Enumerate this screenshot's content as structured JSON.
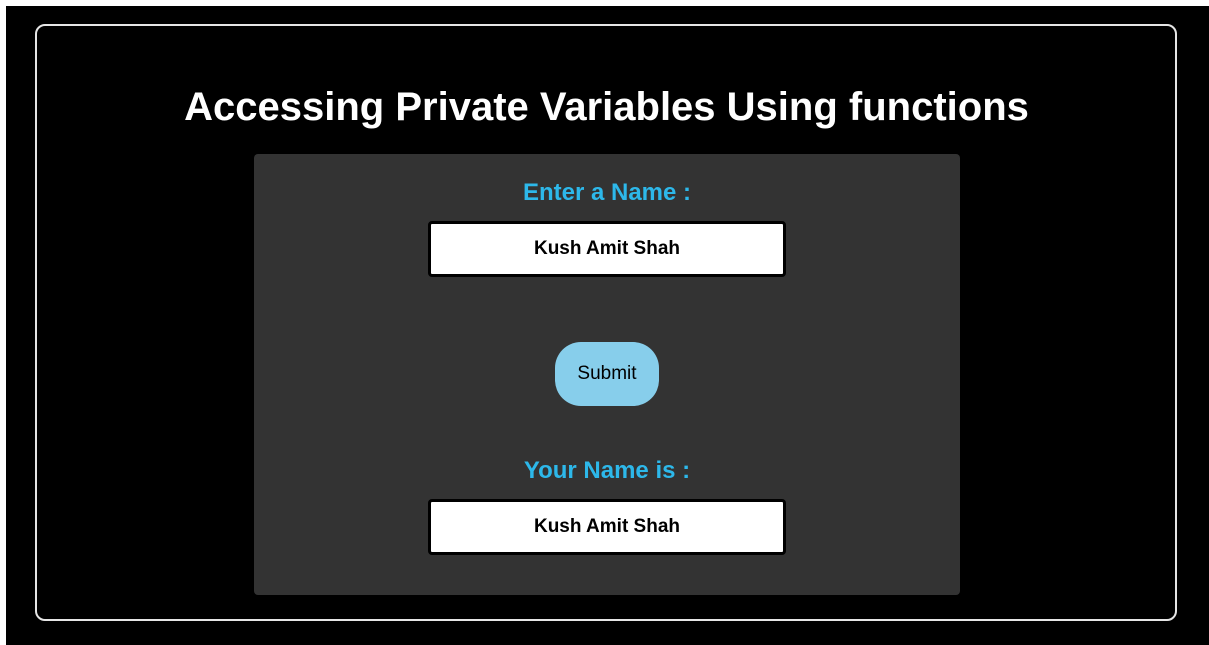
{
  "page": {
    "title": "Accessing Private Variables Using functions"
  },
  "form": {
    "enter_label": "Enter a Name :",
    "name_input_value": "Kush Amit Shah",
    "submit_label": "Submit",
    "result_label": "Your Name is :",
    "result_value": "Kush Amit Shah"
  },
  "colors": {
    "background": "#000000",
    "panel": "#333333",
    "label": "#2db8ea",
    "button": "#87ceeb"
  }
}
